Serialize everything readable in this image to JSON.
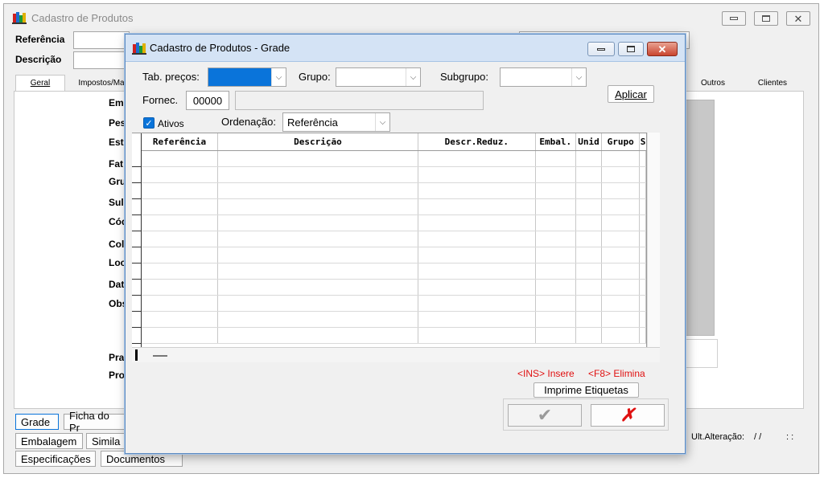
{
  "background": {
    "title": "Cadastro de Produtos",
    "labels": {
      "referencia": "Referência",
      "descricao": "Descrição"
    },
    "tabs": [
      "Geral",
      "Impostos/Ma",
      "Outros",
      "Clientes"
    ],
    "fields": [
      "Em",
      "Pes",
      "Est",
      "Fat",
      "Gru",
      "Sul",
      "Cód",
      "Col",
      "Loc",
      "Dat",
      "Obs",
      "Pra",
      "Pro"
    ],
    "buttons": [
      "Grade",
      "Ficha do Pr",
      "Embalagem",
      "Simila",
      "Especificações",
      "Documentos"
    ],
    "ult_alteracao_label": "Ult.Alteração:",
    "ult_alteracao_value": "/ /",
    "ult_alteracao_time": ": :"
  },
  "dialog": {
    "title": "Cadastro de Produtos - Grade",
    "tab_precos_label": "Tab. preços:",
    "grupo_label": "Grupo:",
    "subgrupo_label": "Subgrupo:",
    "fornec_label": "Fornec.",
    "fornec_value": "00000",
    "aplicar_label": "Aplicar",
    "ativos_label": "Ativos",
    "ativos_checked": true,
    "ordenacao_label": "Ordenação:",
    "ordenacao_value": "Referência",
    "columns": [
      "Referência",
      "Descrição",
      "Descr.Reduz.",
      "Embal.",
      "Unid",
      "Grupo",
      "S"
    ],
    "hint_ins": "<INS> Insere",
    "hint_f8": "<F8> Elimina",
    "imprime_label": "Imprime Etiquetas",
    "icons": {
      "confirm": "check-icon",
      "cancel": "x-icon"
    },
    "colors": {
      "accent": "#0a74da",
      "hint": "#e01010",
      "cancel": "#e01010"
    }
  }
}
